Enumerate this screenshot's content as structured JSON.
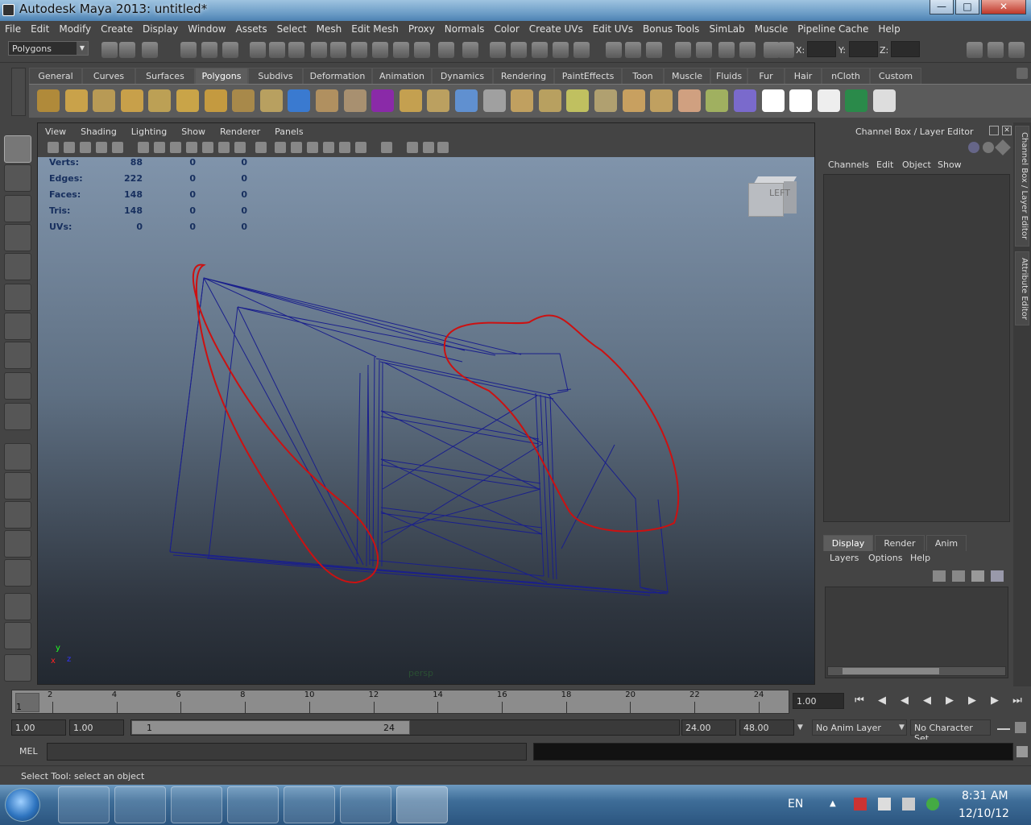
{
  "window": {
    "title": "Autodesk Maya 2013: untitled*"
  },
  "menubar": [
    "File",
    "Edit",
    "Modify",
    "Create",
    "Display",
    "Window",
    "Assets",
    "Select",
    "Mesh",
    "Edit Mesh",
    "Proxy",
    "Normals",
    "Color",
    "Create UVs",
    "Edit UVs",
    "Bonus Tools",
    "SimLab",
    "Muscle",
    "Pipeline Cache",
    "Help"
  ],
  "status": {
    "mode": "Polygons",
    "x_label": "X:",
    "y_label": "Y:",
    "z_label": "Z:"
  },
  "shelf_tabs": [
    "General",
    "Curves",
    "Surfaces",
    "Polygons",
    "Subdivs",
    "Deformation",
    "Animation",
    "Dynamics",
    "Rendering",
    "PaintEffects",
    "Toon",
    "Muscle",
    "Fluids",
    "Fur",
    "Hair",
    "nCloth",
    "Custom"
  ],
  "active_shelf": "Polygons",
  "panel_menu": [
    "View",
    "Shading",
    "Lighting",
    "Show",
    "Renderer",
    "Panels"
  ],
  "hud": [
    {
      "label": "Verts:",
      "v1": "88",
      "v2": "0",
      "v3": "0"
    },
    {
      "label": "Edges:",
      "v1": "222",
      "v2": "0",
      "v3": "0"
    },
    {
      "label": "Faces:",
      "v1": "148",
      "v2": "0",
      "v3": "0"
    },
    {
      "label": "Tris:",
      "v1": "148",
      "v2": "0",
      "v3": "0"
    },
    {
      "label": "UVs:",
      "v1": "0",
      "v2": "0",
      "v3": "0"
    }
  ],
  "viewcube_label": "LEFT",
  "camera_label": "persp",
  "axis": {
    "y": "y",
    "x": "x",
    "z": "z"
  },
  "channel_box": {
    "title": "Channel Box / Layer Editor",
    "menu": [
      "Channels",
      "Edit",
      "Object",
      "Show"
    ],
    "layer_tabs": [
      "Display",
      "Render",
      "Anim"
    ],
    "layer_menu": [
      "Layers",
      "Options",
      "Help"
    ]
  },
  "side_tabs": [
    "Channel Box / Layer Editor",
    "Attribute Editor"
  ],
  "timeline": {
    "current_frame": "1",
    "ticks": [
      "2",
      "4",
      "6",
      "8",
      "10",
      "12",
      "14",
      "16",
      "18",
      "20",
      "22",
      "24"
    ],
    "current_time": "1.00"
  },
  "range": {
    "start": "1.00",
    "start2": "1.00",
    "thumb_start": "1",
    "thumb_end": "24",
    "end": "24.00",
    "end2": "48.00",
    "anim_layer": "No Anim Layer",
    "char_set": "No Character Set"
  },
  "cmd": {
    "label": "MEL"
  },
  "help_text": "Select Tool: select an object",
  "taskbar": {
    "lang": "EN",
    "time": "8:31 AM",
    "date": "12/10/12"
  },
  "colors": {
    "wire": "#1a1f8c",
    "annotation": "#cc1111",
    "hud": "#172f5e"
  }
}
